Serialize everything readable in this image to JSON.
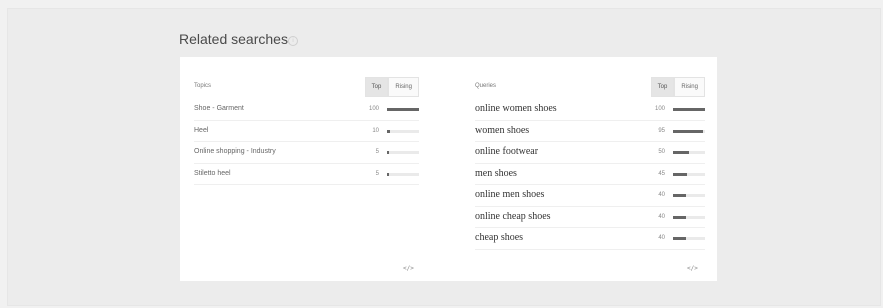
{
  "header": {
    "title": "Related searches",
    "help_icon": "i"
  },
  "topics": {
    "label": "Topics",
    "tabs": [
      {
        "label": "Top",
        "active": true
      },
      {
        "label": "Rising",
        "active": false
      }
    ],
    "rows": [
      {
        "label": "Shoe - Garment",
        "value": "100",
        "fraction": 1.0
      },
      {
        "label": "Heel",
        "value": "10",
        "fraction": 0.1
      },
      {
        "label": "Online shopping - Industry",
        "value": "5",
        "fraction": 0.05
      },
      {
        "label": "Stiletto heel",
        "value": "5",
        "fraction": 0.05
      }
    ],
    "embed_icon": "</>"
  },
  "queries": {
    "label": "Queries",
    "tabs": [
      {
        "label": "Top",
        "active": true
      },
      {
        "label": "Rising",
        "active": false
      }
    ],
    "rows": [
      {
        "label": "online women shoes",
        "value": "100",
        "fraction": 1.0
      },
      {
        "label": "women shoes",
        "value": "95",
        "fraction": 0.95
      },
      {
        "label": "online footwear",
        "value": "50",
        "fraction": 0.5
      },
      {
        "label": "men shoes",
        "value": "45",
        "fraction": 0.45
      },
      {
        "label": "online men shoes",
        "value": "40",
        "fraction": 0.4
      },
      {
        "label": "online cheap shoes",
        "value": "40",
        "fraction": 0.4
      },
      {
        "label": "cheap shoes",
        "value": "40",
        "fraction": 0.4
      }
    ],
    "embed_icon": "</>"
  },
  "colors": {
    "bar_fill": "#666666",
    "bar_track": "#eaeaea",
    "card_bg": "#ffffff"
  }
}
